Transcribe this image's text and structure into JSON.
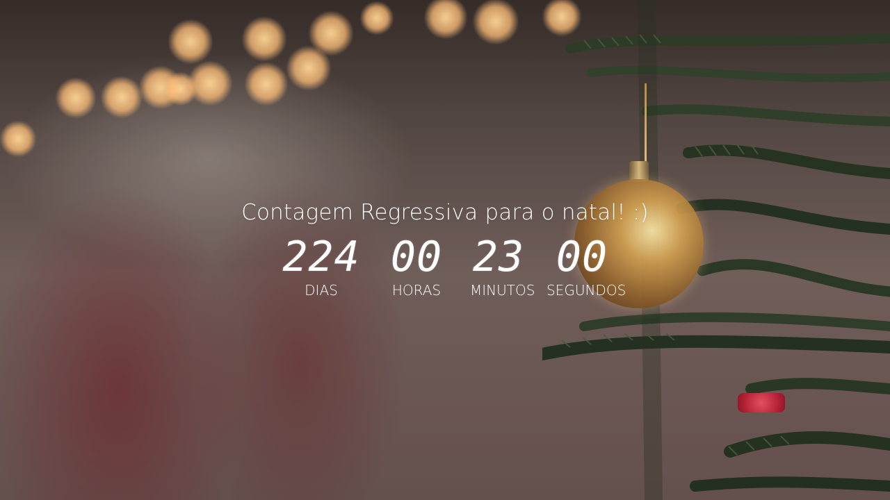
{
  "countdown": {
    "title": "Contagem Regressiva para o natal! :)",
    "units": [
      {
        "value": "224",
        "label": "DIAS"
      },
      {
        "value": "00",
        "label": "HORAS"
      },
      {
        "value": "23",
        "label": "MINUTOS"
      },
      {
        "value": "00",
        "label": "SEGUNDOS"
      }
    ]
  },
  "theme": {
    "text_color": "#ffffff",
    "accent_gold": "#d1b47a",
    "accent_red": "#b62236"
  }
}
